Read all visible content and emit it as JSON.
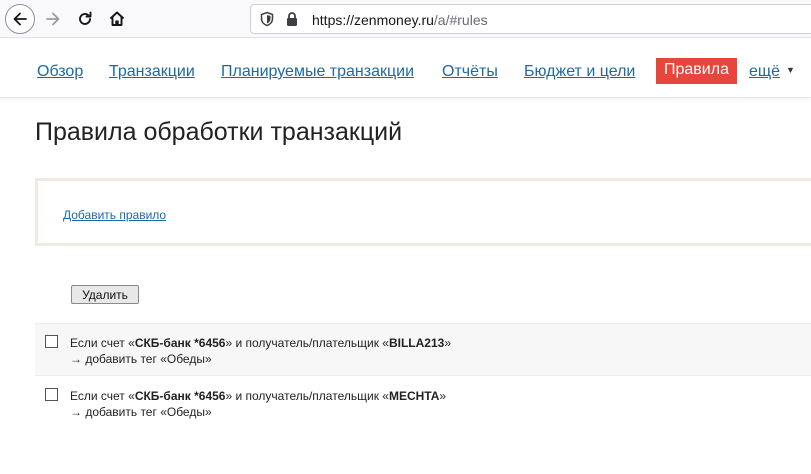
{
  "browser": {
    "url_host": "https://zenmoney.ru",
    "url_path": "/a/#rules"
  },
  "nav": {
    "items": [
      {
        "label": "Обзор"
      },
      {
        "label": "Транзакции"
      },
      {
        "label": "Планируемые транзакции"
      },
      {
        "label": "Отчёты"
      },
      {
        "label": "Бюджет и цели"
      }
    ],
    "active_label": "Правила",
    "more_label": "ещё",
    "active_color": "#e8453c",
    "link_color": "#1b6aa5"
  },
  "page": {
    "title": "Правила обработки транзакций",
    "add_rule_label": "Добавить правило",
    "delete_label": "Удалить"
  },
  "rules": [
    {
      "prefix": "Если счет «",
      "account": "СКБ-банк *6456",
      "middle": "» и получатель/плательщик «",
      "payee": "BILLA213",
      "suffix": "»",
      "action": "→ добавить тег «Обеды»",
      "checked": false
    },
    {
      "prefix": "Если счет «",
      "account": "СКБ-банк *6456",
      "middle": "» и получатель/плательщик «",
      "payee": "MECHTA",
      "suffix": "»",
      "action": "→ добавить тег «Обеды»",
      "checked": false
    }
  ]
}
